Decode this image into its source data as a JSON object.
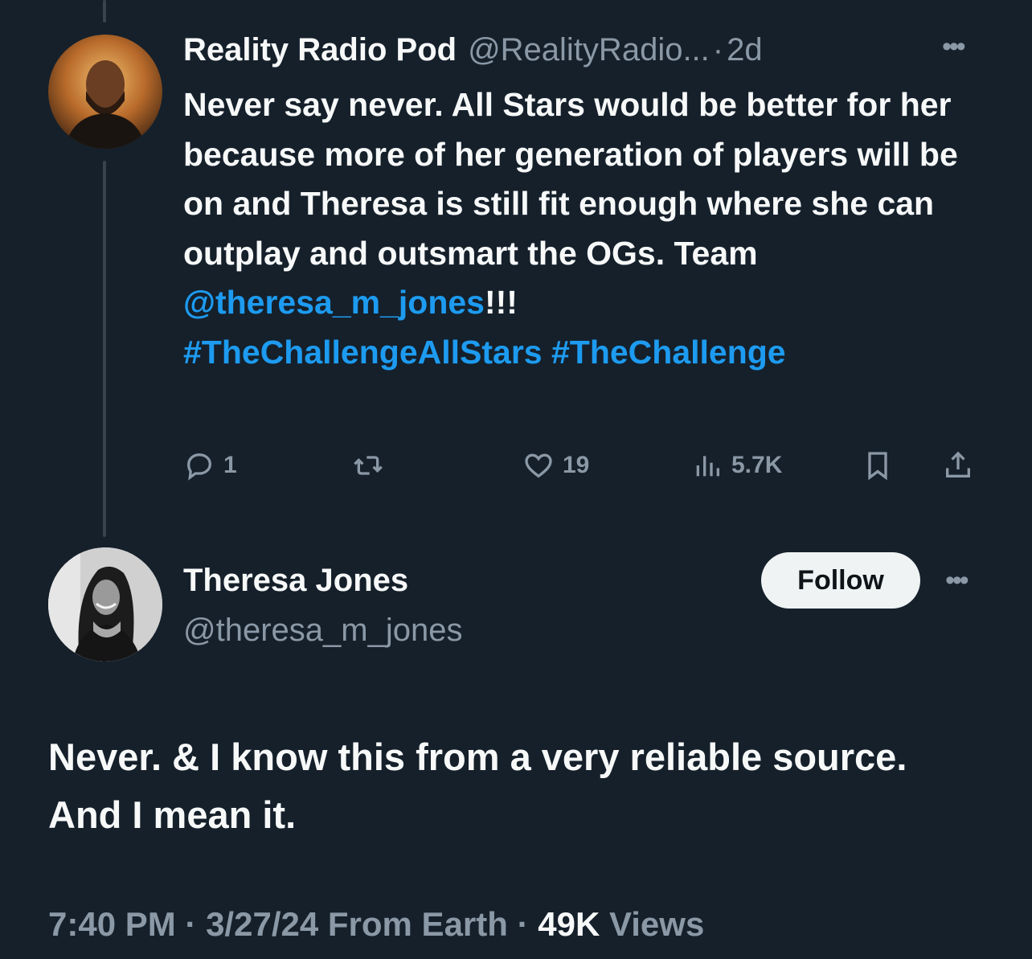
{
  "reply_to": {
    "author_name": "Reality Radio Pod",
    "handle": "@RealityRadio...",
    "separator": "·",
    "time_ago": "2d",
    "more_icon": "more-dots-icon",
    "body": {
      "text": "Never say never. All Stars would be better for her because more of her generation of players will be on and Theresa is still fit enough where she can outplay and outsmart the OGs. Team ",
      "mention": "@theresa_m_jones",
      "after_mention": "!!!",
      "hashtag1": "#TheChallengeAllStars",
      "hashtag2": "#TheChallenge"
    },
    "actions": {
      "reply_count": "1",
      "retweet_count": "",
      "like_count": "19",
      "views_count": "5.7K"
    }
  },
  "tweet": {
    "author_name": "Theresa Jones",
    "handle": "@theresa_m_jones",
    "follow_label": "Follow",
    "body": "Never. & I know this from a very reliable source. And I mean it.",
    "meta": {
      "time": "7:40 PM",
      "sep1": "·",
      "date": "3/27/24",
      "source": "From Earth",
      "sep2": "·",
      "views_count": "49K",
      "views_label": "Views"
    }
  },
  "colors": {
    "background": "#15202b",
    "text_primary": "#f7f9f9",
    "text_secondary": "#8b98a5",
    "link": "#1d9bf0",
    "thread_line": "#38444d",
    "follow_bg": "#eff3f4"
  }
}
